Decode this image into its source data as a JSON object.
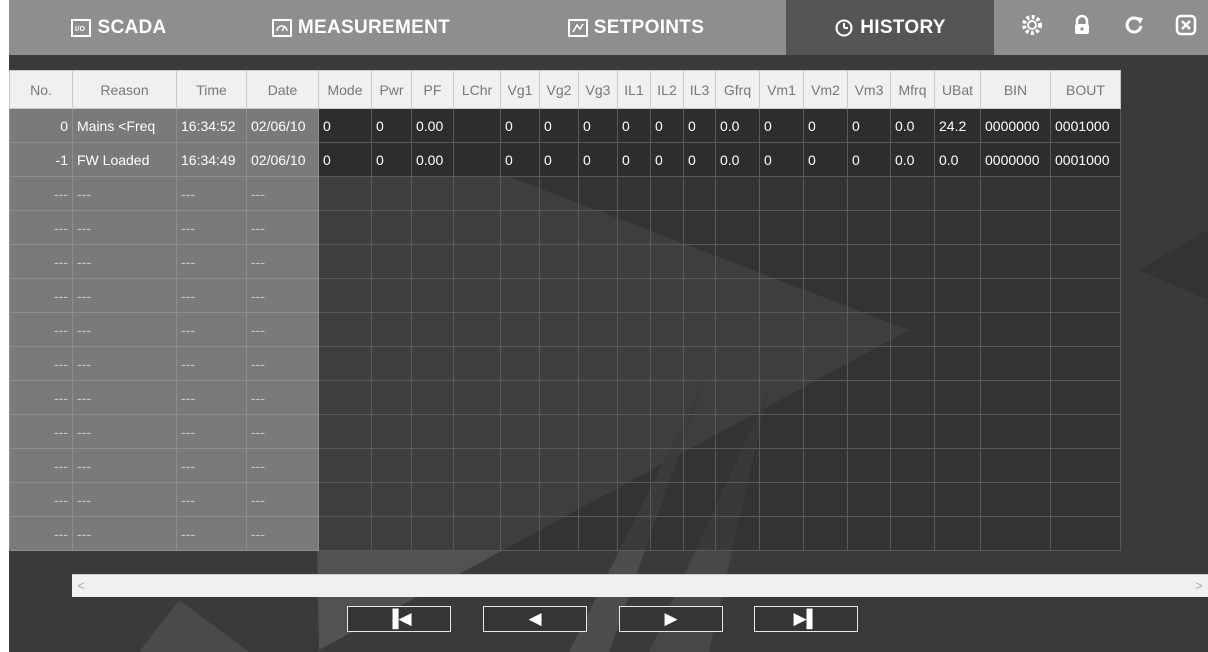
{
  "tabs": [
    {
      "id": "scada",
      "label": "SCADA",
      "icon": "scada-icon",
      "active": false
    },
    {
      "id": "measurement",
      "label": "MEASUREMENT",
      "icon": "gauge-icon",
      "active": false
    },
    {
      "id": "setpoints",
      "label": "SETPOINTS",
      "icon": "setpoints-icon",
      "active": false
    },
    {
      "id": "history",
      "label": "HISTORY",
      "icon": "history-icon",
      "active": true
    }
  ],
  "toolbar": {
    "icons": [
      "settings-gear-icon",
      "lock-icon",
      "refresh-icon",
      "close-icon"
    ]
  },
  "table": {
    "columns": [
      "No.",
      "Reason",
      "Time",
      "Date",
      "Mode",
      "Pwr",
      "PF",
      "LChr",
      "Vg1",
      "Vg2",
      "Vg3",
      "IL1",
      "IL2",
      "IL3",
      "Gfrq",
      "Vm1",
      "Vm2",
      "Vm3",
      "Mfrq",
      "UBat",
      "BIN",
      "BOUT"
    ],
    "rows": [
      [
        "0",
        "Mains <Freq",
        "16:34:52",
        "02/06/10",
        "0",
        "0",
        "0.00",
        "",
        "0",
        "0",
        "0",
        "0",
        "0",
        "0",
        "0.0",
        "0",
        "0",
        "0",
        "0.0",
        "24.2",
        "0000000",
        "0001000"
      ],
      [
        "-1",
        "FW Loaded",
        "16:34:49",
        "02/06/10",
        "0",
        "0",
        "0.00",
        "",
        "0",
        "0",
        "0",
        "0",
        "0",
        "0",
        "0.0",
        "0",
        "0",
        "0",
        "0.0",
        "0.0",
        "0000000",
        "0001000"
      ],
      [
        "---",
        "---",
        "---",
        "---"
      ],
      [
        "---",
        "---",
        "---",
        "---"
      ],
      [
        "---",
        "---",
        "---",
        "---"
      ],
      [
        "---",
        "---",
        "---",
        "---"
      ],
      [
        "---",
        "---",
        "---",
        "---"
      ],
      [
        "---",
        "---",
        "---",
        "---"
      ],
      [
        "---",
        "---",
        "---",
        "---"
      ],
      [
        "---",
        "---",
        "---",
        "---"
      ],
      [
        "---",
        "---",
        "---",
        "---"
      ],
      [
        "---",
        "---",
        "---",
        "---"
      ],
      [
        "---",
        "---",
        "---",
        "---"
      ]
    ]
  },
  "scrollbar": {
    "left_arrow": "<",
    "right_arrow": ">"
  },
  "pager": {
    "first": "▐◀",
    "prev": "◀",
    "next": "▶",
    "last": "▶▌"
  },
  "colors": {
    "topbar": "#8e8e8e",
    "active_tab": "#555555",
    "background": "#3a3a3a",
    "fixed_cells": "#7a7a7a",
    "header_cells": "#f0f0f0"
  }
}
